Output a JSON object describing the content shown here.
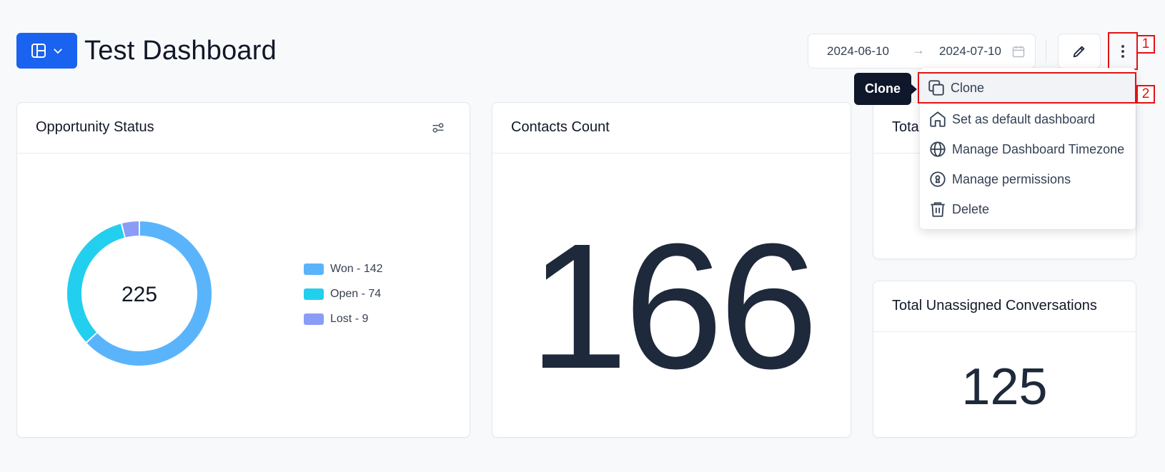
{
  "header": {
    "title": "Test Dashboard",
    "date_start": "2024-06-10",
    "date_arrow": "→",
    "date_end": "2024-07-10"
  },
  "annotations": {
    "mark1": "1",
    "mark2": "2"
  },
  "cards": {
    "opportunity": {
      "title": "Opportunity Status",
      "total": "225",
      "legend": [
        "Won - 142",
        "Open - 74",
        "Lost - 9"
      ]
    },
    "contacts": {
      "title": "Contacts Count",
      "value": "166"
    },
    "total_partial": {
      "title": "Tota"
    },
    "unassigned": {
      "title": "Total Unassigned Conversations",
      "value": "125"
    }
  },
  "chart_data": {
    "type": "pie",
    "categories": [
      "Won",
      "Open",
      "Lost"
    ],
    "values": [
      142,
      74,
      9
    ],
    "colors": [
      "#5ab4fb",
      "#23cfee",
      "#8b9cf7"
    ],
    "center_label": "225"
  },
  "menu": {
    "items": [
      {
        "label": "Clone",
        "icon": "copy-icon"
      },
      {
        "label": "Set as default dashboard",
        "icon": "home-icon"
      },
      {
        "label": "Manage Dashboard Timezone",
        "icon": "globe-icon"
      },
      {
        "label": "Manage permissions",
        "icon": "keyhole-icon"
      },
      {
        "label": "Delete",
        "icon": "trash-icon"
      }
    ]
  },
  "tooltip": {
    "text": "Clone"
  },
  "colors": {
    "accent": "#1a62f0",
    "highlight": "#e31212",
    "tooltip_bg": "#0f172a"
  }
}
